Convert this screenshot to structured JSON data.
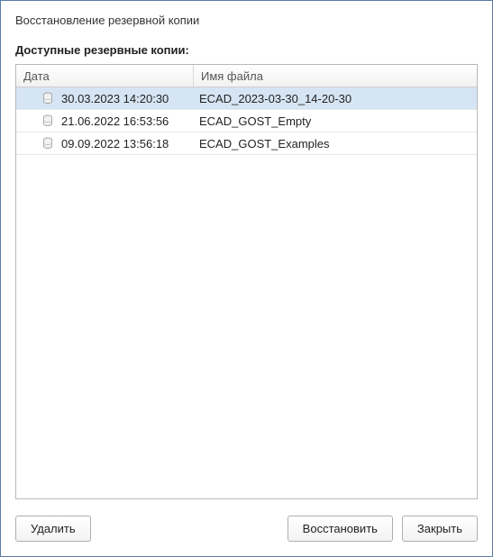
{
  "dialog": {
    "title": "Восстановление резервной копии"
  },
  "section": {
    "label": "Доступные резервные копии:"
  },
  "columns": {
    "date": "Дата",
    "file": "Имя файла"
  },
  "rows": [
    {
      "date": "30.03.2023 14:20:30",
      "file": "ECAD_2023-03-30_14-20-30",
      "selected": true
    },
    {
      "date": "21.06.2022 16:53:56",
      "file": "ECAD_GOST_Empty",
      "selected": false
    },
    {
      "date": "09.09.2022 13:56:18",
      "file": "ECAD_GOST_Examples",
      "selected": false
    }
  ],
  "buttons": {
    "delete": "Удалить",
    "restore": "Восстановить",
    "close": "Закрыть"
  }
}
